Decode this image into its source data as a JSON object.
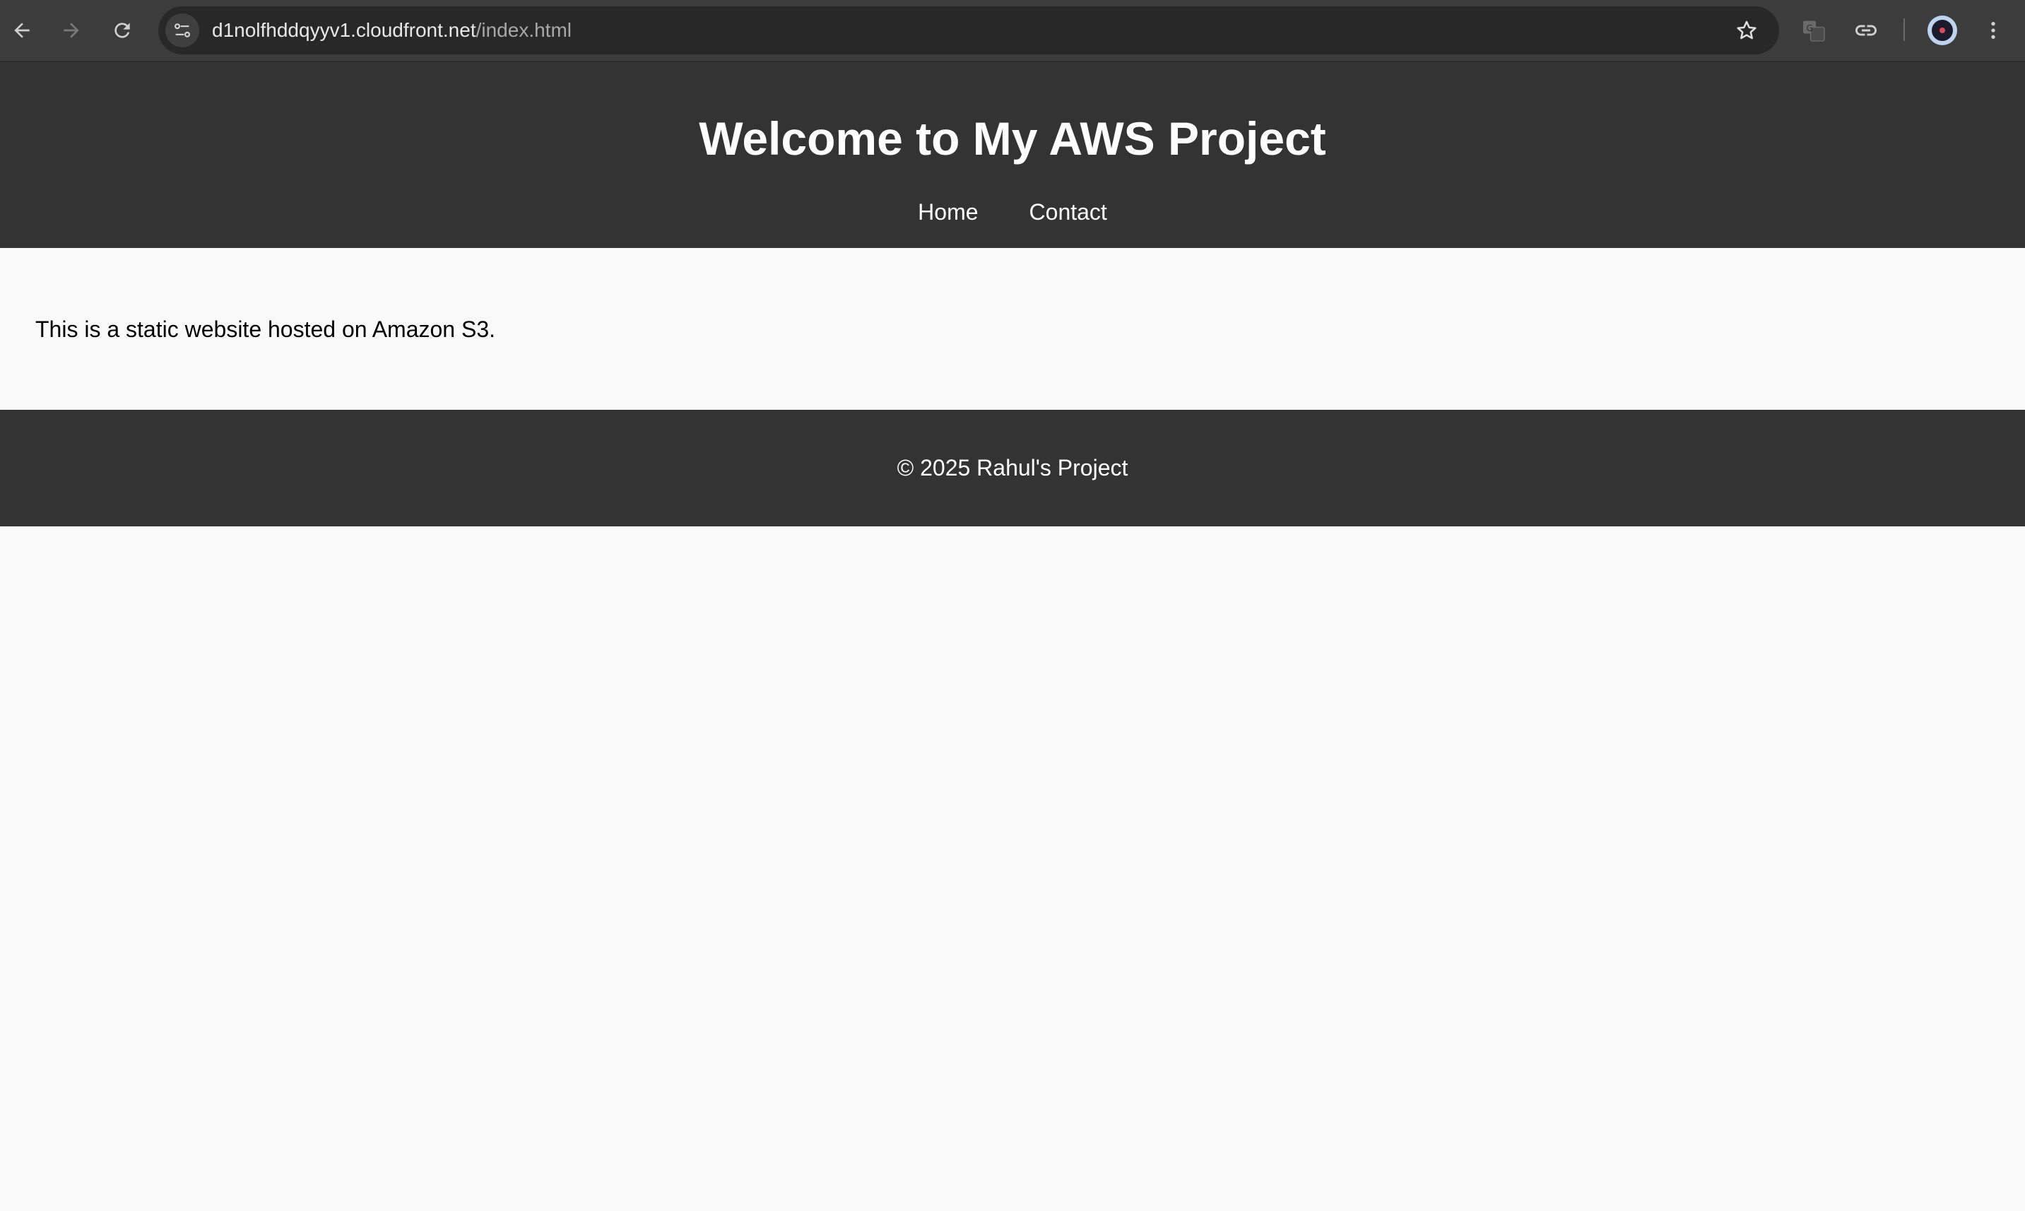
{
  "browser": {
    "url_host": "d1nolfhddqyyv1.cloudfront.net",
    "url_path": "/index.html",
    "icons": [
      "back-icon",
      "forward-icon",
      "reload-icon",
      "site-info-icon",
      "bookmark-star-icon",
      "translate-icon",
      "link-icon",
      "profile-avatar",
      "menu-kebab-icon"
    ]
  },
  "header": {
    "title": "Welcome to My AWS Project",
    "nav": [
      {
        "label": "Home"
      },
      {
        "label": "Contact"
      }
    ]
  },
  "main": {
    "text": "This is a static website hosted on Amazon S3."
  },
  "footer": {
    "text": "© 2025 Rahul's Project"
  },
  "colors": {
    "header_bg": "#333333",
    "page_bg": "#f9f9f9",
    "toolbar_bg": "#3c3c3c"
  }
}
